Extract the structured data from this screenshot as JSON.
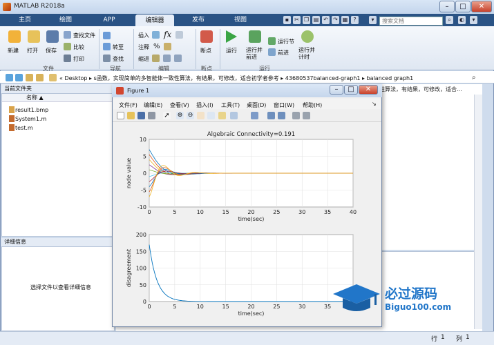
{
  "window": {
    "title": "MATLAB R2018a"
  },
  "ribbon_tabs": [
    "主页",
    "绘图",
    "APP",
    "编辑器",
    "发布",
    "视图"
  ],
  "search": {
    "placeholder": "搜索文档"
  },
  "ribbon": {
    "file": {
      "new": "新建",
      "open": "打开",
      "save": "保存",
      "find_files": "查找文件",
      "compare": "比较",
      "print": "打印",
      "group": "文件"
    },
    "nav": {
      "goto": "转至",
      "find": "查找",
      "group": "导航"
    },
    "edit": {
      "insert": "插入",
      "comment": "注释",
      "indent": "缩进",
      "group": "编辑"
    },
    "breakpoints": {
      "label": "断点",
      "group": "断点"
    },
    "run": {
      "run": "运行",
      "run_advance": "运行并\n前进",
      "run_section": "运行节",
      "advance": "前进",
      "run_time": "运行并\n计时",
      "group": "运行"
    }
  },
  "address": {
    "path": "« Desktop ▸ s函数，实现简单的多智能体一致性算法，有结果，可修改，适合初学者参考 ▸ 43680537balanced-graph1 ▸ balanced graph1"
  },
  "current_folder": {
    "title": "当前文件夹",
    "col_name": "名称 ▲",
    "files": [
      "result1.bmp",
      "System1.m",
      "test.m"
    ]
  },
  "details": {
    "title": "详细信息",
    "message": "选择文件以查看详细信息"
  },
  "editor": {
    "tab_text": "性算法，有结果，可修改，适合..."
  },
  "status": {
    "row": "行",
    "row_val": "1",
    "col": "列",
    "col_val": "1"
  },
  "figure": {
    "title": "Figure 1",
    "menu": [
      "文件(F)",
      "编辑(E)",
      "查看(V)",
      "插入(I)",
      "工具(T)",
      "桌面(D)",
      "窗口(W)",
      "帮助(H)"
    ]
  },
  "chart_data": [
    {
      "type": "line",
      "title": "Algebraic Connectivity=0.191",
      "xlabel": "time(sec)",
      "ylabel": "node value",
      "xlim": [
        0,
        40
      ],
      "ylim": [
        -10,
        10
      ],
      "xticks": [
        0,
        5,
        10,
        15,
        20,
        25,
        30,
        35,
        40
      ],
      "yticks": [
        -10,
        -5,
        0,
        5,
        10
      ],
      "grid": true,
      "series_initial_values": [
        7,
        5.5,
        4,
        2.5,
        1,
        -1,
        -2.5,
        -4,
        -5.5,
        -7
      ],
      "decay_rate": 0.38,
      "oscillation_freq": 0.9
    },
    {
      "type": "line",
      "title": "",
      "xlabel": "time(sec)",
      "ylabel": "disagreement",
      "xlim": [
        0,
        40
      ],
      "ylim": [
        0,
        200
      ],
      "xticks": [
        0,
        5,
        10,
        15,
        20,
        25,
        30,
        35,
        40
      ],
      "yticks": [
        0,
        50,
        100,
        150,
        200
      ],
      "grid": true,
      "initial_value": 170,
      "decay_rate": 0.65
    }
  ],
  "watermark": {
    "line1": "必过源码",
    "line2": "Biguo100.com"
  },
  "colors": {
    "series": [
      "#0072bd",
      "#d95319",
      "#edb120",
      "#7e2f8e",
      "#77ac30",
      "#4dbeee",
      "#a2142f",
      "#0072bd",
      "#d95319",
      "#edb120"
    ]
  }
}
